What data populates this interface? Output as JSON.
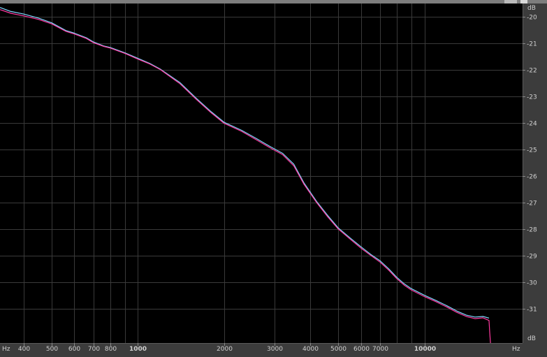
{
  "chart_data": {
    "type": "line",
    "x_scale": "log",
    "xlim": [
      330,
      22000
    ],
    "ylim": [
      -19.5,
      -32.3
    ],
    "x_unit": "Hz",
    "y_unit": "dB",
    "x_ticks": [
      {
        "value": 400,
        "label": "400"
      },
      {
        "value": 500,
        "label": "500"
      },
      {
        "value": 600,
        "label": "600"
      },
      {
        "value": 700,
        "label": "700"
      },
      {
        "value": 800,
        "label": "800"
      },
      {
        "value": 1000,
        "label": "1000"
      },
      {
        "value": 2000,
        "label": "2000"
      },
      {
        "value": 3000,
        "label": "3000"
      },
      {
        "value": 4000,
        "label": "4000"
      },
      {
        "value": 5000,
        "label": "5000"
      },
      {
        "value": 6000,
        "label": "6000"
      },
      {
        "value": 7000,
        "label": "7000"
      },
      {
        "value": 10000,
        "label": "10000"
      }
    ],
    "x_grid_minor": [
      900,
      8000,
      9000
    ],
    "y_ticks": [
      {
        "value": -20,
        "label": "-20"
      },
      {
        "value": -21,
        "label": "-21"
      },
      {
        "value": -22,
        "label": "-22"
      },
      {
        "value": -23,
        "label": "-23"
      },
      {
        "value": -24,
        "label": "-24"
      },
      {
        "value": -25,
        "label": "-25"
      },
      {
        "value": -26,
        "label": "-26"
      },
      {
        "value": -27,
        "label": "-27"
      },
      {
        "value": -28,
        "label": "-28"
      },
      {
        "value": -29,
        "label": "-29"
      },
      {
        "value": -30,
        "label": "-30"
      },
      {
        "value": -31,
        "label": "-31"
      }
    ],
    "grid": true,
    "series": [
      {
        "color": "#ff3aa0",
        "x": [
          330,
          360,
          400,
          450,
          500,
          560,
          600,
          660,
          700,
          760,
          800,
          900,
          1000,
          1100,
          1200,
          1400,
          1600,
          1800,
          2000,
          2300,
          2600,
          2900,
          3200,
          3500,
          3800,
          4200,
          4600,
          5000,
          5500,
          6000,
          6500,
          7000,
          7500,
          8000,
          8500,
          9000,
          10000,
          11000,
          12000,
          13000,
          14000,
          15000,
          16000,
          16800,
          16900,
          17000
        ],
        "y": [
          -19.73,
          -19.87,
          -19.97,
          -20.1,
          -20.27,
          -20.55,
          -20.65,
          -20.82,
          -20.98,
          -21.12,
          -21.18,
          -21.38,
          -21.6,
          -21.78,
          -22.0,
          -22.52,
          -23.12,
          -23.62,
          -24.02,
          -24.32,
          -24.65,
          -24.95,
          -25.2,
          -25.62,
          -26.32,
          -27.0,
          -27.55,
          -28.0,
          -28.38,
          -28.72,
          -29.0,
          -29.25,
          -29.55,
          -29.87,
          -30.12,
          -30.3,
          -30.55,
          -30.75,
          -30.95,
          -31.15,
          -31.3,
          -31.38,
          -31.35,
          -31.45,
          -31.9,
          -32.3
        ]
      },
      {
        "color": "#7fd8ff",
        "x": [
          330,
          360,
          400,
          450,
          500,
          560,
          600,
          660,
          700,
          760,
          800,
          900,
          1000,
          1100,
          1200,
          1400,
          1600,
          1800,
          2000,
          2300,
          2600,
          2900,
          3200,
          3500,
          3800,
          4200,
          4600,
          5000,
          5500,
          6000,
          6500,
          7000,
          7500,
          8000,
          8500,
          9000,
          10000,
          11000,
          12000,
          13000,
          14000,
          15000,
          16000,
          16800
        ],
        "y": [
          -19.65,
          -19.8,
          -19.9,
          -20.05,
          -20.23,
          -20.52,
          -20.62,
          -20.79,
          -20.95,
          -21.1,
          -21.16,
          -21.36,
          -21.57,
          -21.76,
          -21.98,
          -22.48,
          -23.08,
          -23.58,
          -23.98,
          -24.28,
          -24.6,
          -24.9,
          -25.15,
          -25.56,
          -26.27,
          -26.96,
          -27.5,
          -27.96,
          -28.34,
          -28.67,
          -28.96,
          -29.2,
          -29.5,
          -29.82,
          -30.07,
          -30.25,
          -30.5,
          -30.7,
          -30.9,
          -31.1,
          -31.25,
          -31.32,
          -31.3,
          -31.36
        ]
      }
    ]
  }
}
